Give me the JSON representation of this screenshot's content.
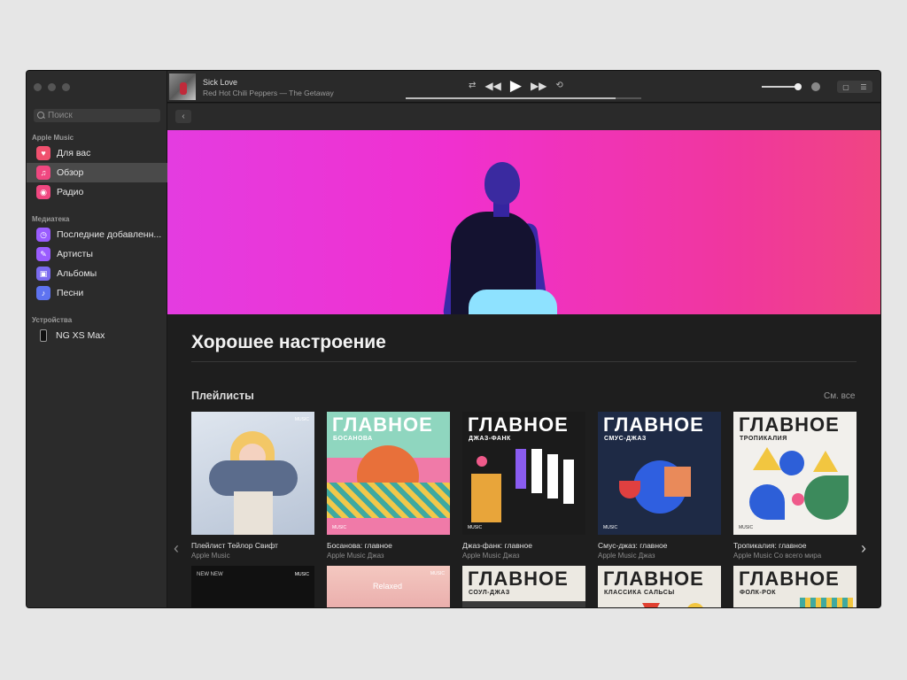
{
  "sidebar": {
    "search_placeholder": "Поиск",
    "sections": [
      {
        "title": "Apple Music"
      },
      {
        "title": "Медиатека"
      },
      {
        "title": "Устройства"
      }
    ],
    "items": [
      {
        "label": "Для вас",
        "icon": "heart-icon"
      },
      {
        "label": "Обзор",
        "icon": "music-note-icon",
        "active": true
      },
      {
        "label": "Радио",
        "icon": "radio-icon"
      },
      {
        "label": "Последние добавленн...",
        "icon": "clock-icon"
      },
      {
        "label": "Артисты",
        "icon": "microphone-icon"
      },
      {
        "label": "Альбомы",
        "icon": "album-icon"
      },
      {
        "label": "Песни",
        "icon": "note-icon"
      },
      {
        "label": "NG XS Max",
        "icon": "phone-icon"
      }
    ]
  },
  "player": {
    "track_title": "Sick Love",
    "track_artist": "Red Hot Chili Peppers — The Getaway",
    "progress": 0.89,
    "volume": 0.95
  },
  "content": {
    "title": "Хорошее настроение",
    "section_title": "Плейлисты",
    "see_all": "См. все",
    "playlists": [
      {
        "name": "Плейлист Тейлор Свифт",
        "sub": "Apple Music",
        "badge": "MUSIC"
      },
      {
        "name": "Босанова: главное",
        "sub": "Apple Music Джаз",
        "label": "ГЛАВНОЕ",
        "genre": "БОСАНОВА",
        "badge": "MUSIC"
      },
      {
        "name": "Джаз-фанк: главное",
        "sub": "Apple Music Джаз",
        "label": "ГЛАВНОЕ",
        "genre": "ДЖАЗ-ФАНК",
        "badge": "MUSIC"
      },
      {
        "name": "Смус-джаз: главное",
        "sub": "Apple Music Джаз",
        "label": "ГЛАВНОЕ",
        "genre": "СМУС-ДЖАЗ",
        "badge": "MUSIC"
      },
      {
        "name": "Тропикалия: главное",
        "sub": "Apple Music Со всего мира",
        "label": "ГЛАВНОЕ",
        "genre": "ТРОПИКАЛИЯ",
        "badge": "MUSIC"
      }
    ],
    "row2": [
      {
        "text": "NEW NEW",
        "badge": "MUSIC"
      },
      {
        "text": "Relaxed",
        "badge": "MUSIC"
      },
      {
        "label": "ГЛАВНОЕ",
        "genre": "СОУЛ-ДЖАЗ"
      },
      {
        "label": "ГЛАВНОЕ",
        "genre": "КЛАССИКА САЛЬСЫ"
      },
      {
        "label": "ГЛАВНОЕ",
        "genre": "ФОЛК-РОК"
      }
    ]
  }
}
